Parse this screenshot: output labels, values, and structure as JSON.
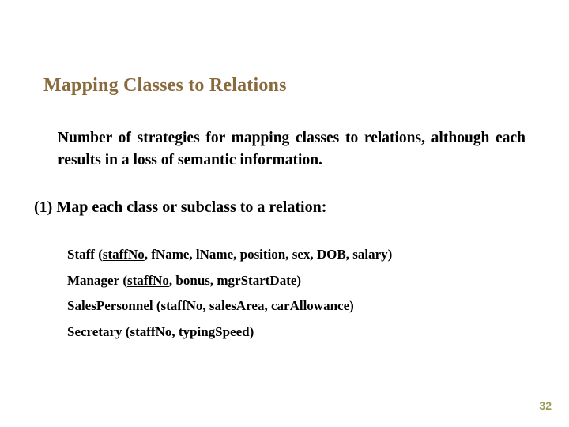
{
  "slide": {
    "title": "Mapping Classes to Relations",
    "intro_paragraph": "Number of strategies for mapping classes to relations, although each results in a loss of semantic information.",
    "step_label": "(1) Map each class or subclass to a relation:",
    "relations": [
      {
        "name": "Staff",
        "open_paren": "(",
        "primary_key": "staffNo",
        "attributes": ", fName, lName, position, sex, DOB, salary)",
        "full_text": "Staff (staffNo, fName, lName, position, sex, DOB, salary)"
      },
      {
        "name": "Manager",
        "open_paren": "(",
        "primary_key": "staffNo",
        "attributes": ", bonus, mgrStartDate)",
        "full_text": "Manager (staffNo, bonus, mgrStartDate)"
      },
      {
        "name": "SalesPersonnel",
        "open_paren": "(",
        "primary_key": "staffNo",
        "attributes": ", salesArea, carAllowance)",
        "full_text": "SalesPersonnel (staffNo, salesArea, carAllowance)"
      },
      {
        "name": "Secretary",
        "open_paren": "(",
        "primary_key": "staffNo",
        "attributes": ", typingSpeed)",
        "full_text": "Secretary (staffNo, typingSpeed)"
      }
    ],
    "page_number": "32"
  },
  "colors": {
    "title": "#8a6a3c",
    "body_text": "#000000",
    "page_number": "#9b9b57",
    "background": "#ffffff"
  }
}
